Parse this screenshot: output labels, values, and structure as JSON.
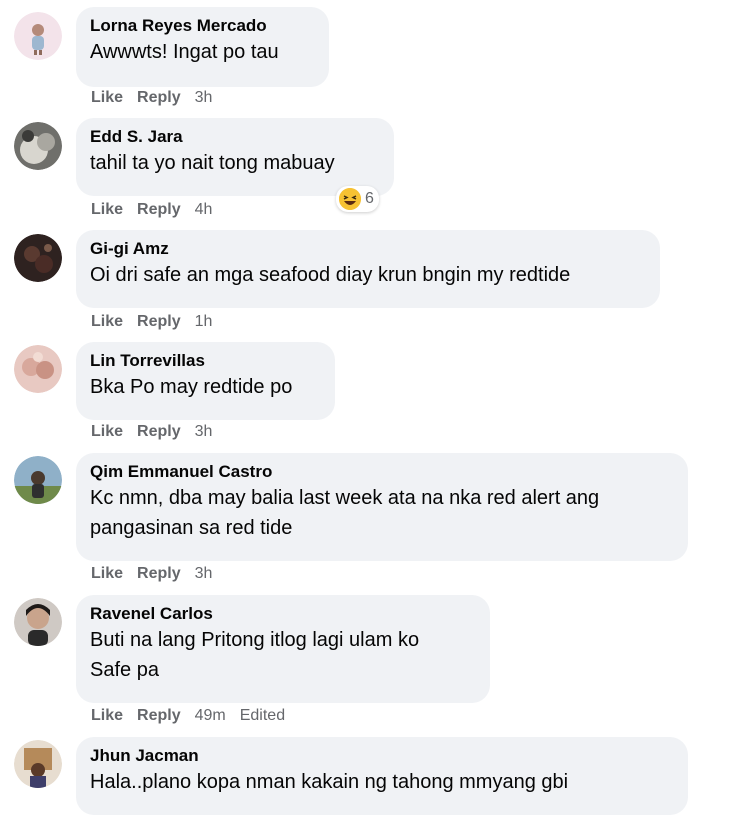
{
  "comments": [
    {
      "name": "Lorna Reyes Mercado",
      "text": "Awwwts! Ingat po tau",
      "like": "Like",
      "reply": "Reply",
      "time": "3h"
    },
    {
      "name": "Edd S. Jara",
      "text": "tahil ta yo nait tong mabuay",
      "like": "Like",
      "reply": "Reply",
      "time": "4h",
      "reaction_count": "6"
    },
    {
      "name": "Gi-gi Amz",
      "text": "Oi dri safe an mga seafood diay krun bngin my redtide",
      "like": "Like",
      "reply": "Reply",
      "time": "1h"
    },
    {
      "name": "Lin Torrevillas",
      "text": "Bka Po may redtide po",
      "like": "Like",
      "reply": "Reply",
      "time": "3h"
    },
    {
      "name": "Qim Emmanuel Castro",
      "text": "Kc nmn, dba may balia last week ata na nka red alert ang\npangasinan sa red tide",
      "like": "Like",
      "reply": "Reply",
      "time": "3h"
    },
    {
      "name": "Ravenel Carlos",
      "text": "Buti na lang Pritong itlog lagi ulam ko\nSafe pa",
      "like": "Like",
      "reply": "Reply",
      "time": "49m",
      "edited": "Edited"
    },
    {
      "name": "Jhun Jacman",
      "text": "Hala..plano kopa nman kakain ng tahong mmyang gbi"
    }
  ],
  "colors": {
    "bubble": "#f0f2f5",
    "meta": "#65676b",
    "reaction": "#f7c233"
  },
  "icons": {
    "reaction": "haha-icon"
  }
}
